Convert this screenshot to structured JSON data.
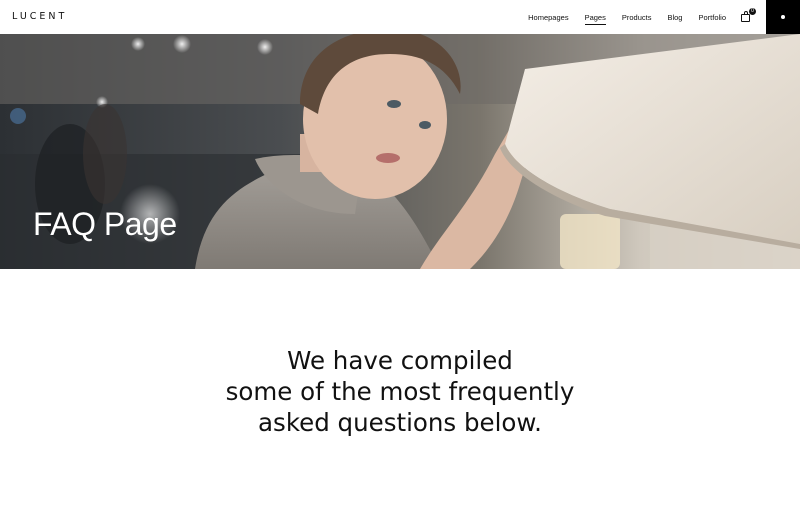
{
  "header": {
    "logo": "LUCENT",
    "nav": [
      {
        "label": "Homepages",
        "active": false
      },
      {
        "label": "Pages",
        "active": true
      },
      {
        "label": "Products",
        "active": false
      },
      {
        "label": "Blog",
        "active": false
      },
      {
        "label": "Portfolio",
        "active": false
      }
    ],
    "cart_count": "0",
    "cart_icon": "shopping-bag-icon",
    "side_menu_icon": "dot-icon"
  },
  "hero": {
    "title": "FAQ Page",
    "image": "woman-touching-lampshade-photo"
  },
  "intro": {
    "lines": [
      "We have compiled",
      "some of the most frequently",
      "asked questions below."
    ]
  }
}
